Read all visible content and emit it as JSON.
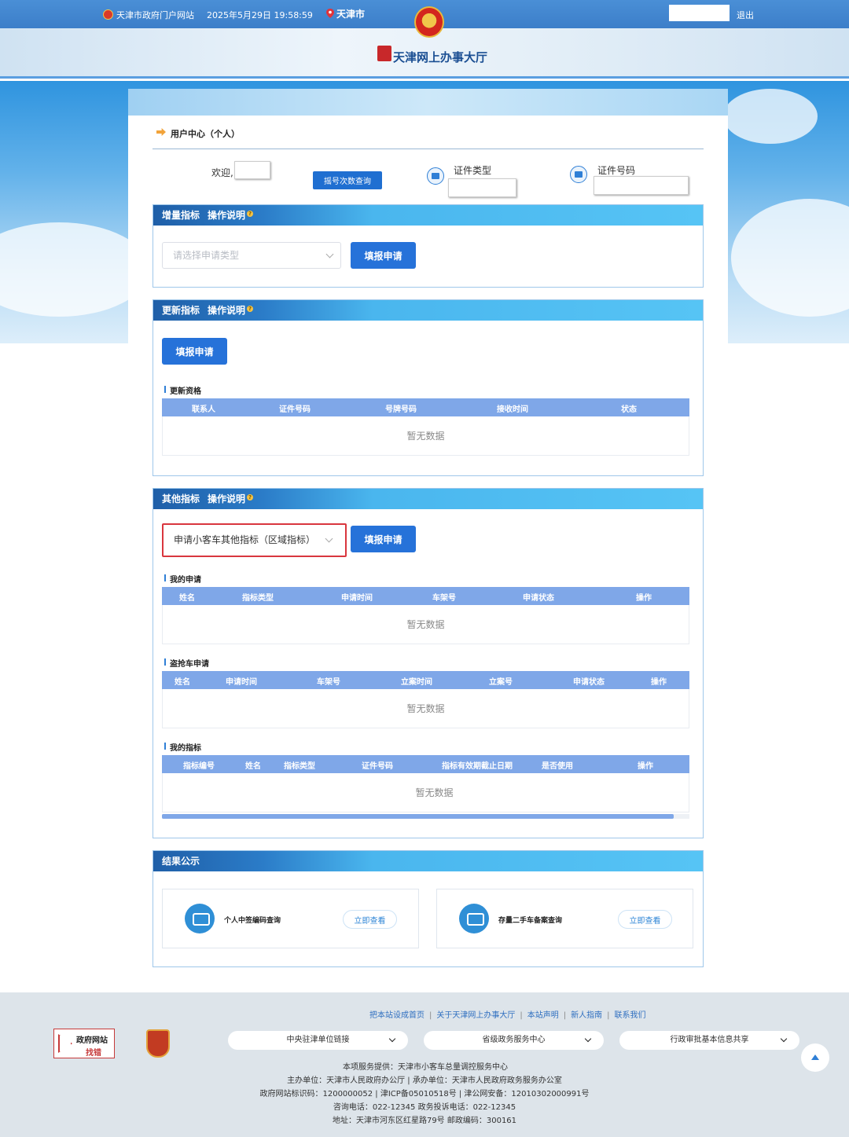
{
  "topbar": {
    "portal": "天津市政府门户网站",
    "datetime": "2025年5月29日 19:58:59",
    "city": "天津市",
    "logout": "退出"
  },
  "header": {
    "hall_title": "天津网上办事大厅"
  },
  "breadcrumb": "用户中心（个人）",
  "user": {
    "welcome": "欢迎,",
    "lottery_query_btn": "摇号次数查询",
    "id_type_label": "证件类型",
    "id_number_label": "证件号码"
  },
  "incremental": {
    "title": "增量指标",
    "help": "操作说明",
    "select_placeholder": "请选择申请类型",
    "apply_btn": "填报申请"
  },
  "renewal": {
    "title": "更新指标",
    "help": "操作说明",
    "apply_btn": "填报申请",
    "sub_title": "更新资格",
    "columns": [
      "联系人",
      "证件号码",
      "号牌号码",
      "接收时间",
      "状态"
    ],
    "empty": "暂无数据"
  },
  "other": {
    "title": "其他指标",
    "help": "操作说明",
    "selected_type": "申请小客车其他指标（区域指标）",
    "apply_btn": "填报申请",
    "my_apply": {
      "title": "我的申请",
      "columns": [
        "姓名",
        "指标类型",
        "申请时间",
        "车架号",
        "申请状态",
        "操作"
      ],
      "empty": "暂无数据"
    },
    "theft": {
      "title": "盗抢车申请",
      "columns": [
        "姓名",
        "申请时间",
        "车架号",
        "立案时间",
        "立案号",
        "申请状态",
        "操作"
      ],
      "empty": "暂无数据"
    },
    "my_index": {
      "title": "我的指标",
      "columns": [
        "指标编号",
        "姓名",
        "指标类型",
        "证件号码",
        "指标有效期截止日期",
        "是否使用",
        "操作"
      ],
      "empty": "暂无数据"
    }
  },
  "results": {
    "title": "结果公示",
    "cards": [
      {
        "label": "个人中签编码查询",
        "btn": "立即查看"
      },
      {
        "label": "存量二手车备案查询",
        "btn": "立即查看"
      }
    ]
  },
  "footer": {
    "links": [
      "把本站设成首页",
      "关于天津网上办事大厅",
      "本站声明",
      "新人指南",
      "联系我们"
    ],
    "gov_badge_line1": "政府网站",
    "gov_badge_line2": "找错",
    "selects": [
      "中央驻津单位链接",
      "省级政务服务中心",
      "行政审批基本信息共享"
    ],
    "info": [
      "本项服务提供：天津市小客车总量调控服务中心",
      "主办单位：天津市人民政府办公厅 | 承办单位：天津市人民政府政务服务办公室",
      "政府网站标识码：1200000052 | 津ICP备05010518号 | 津公网安备：12010302000991号",
      "咨询电话：022-12345 政务投诉电话：022-12345",
      "地址：天津市河东区红星路79号 邮政编码：300161"
    ]
  },
  "colors": {
    "topbar": "#3c7ec9",
    "primary_button": "#2672d9",
    "table_header": "#7fa7e8",
    "highlight_border": "#d9363e"
  }
}
